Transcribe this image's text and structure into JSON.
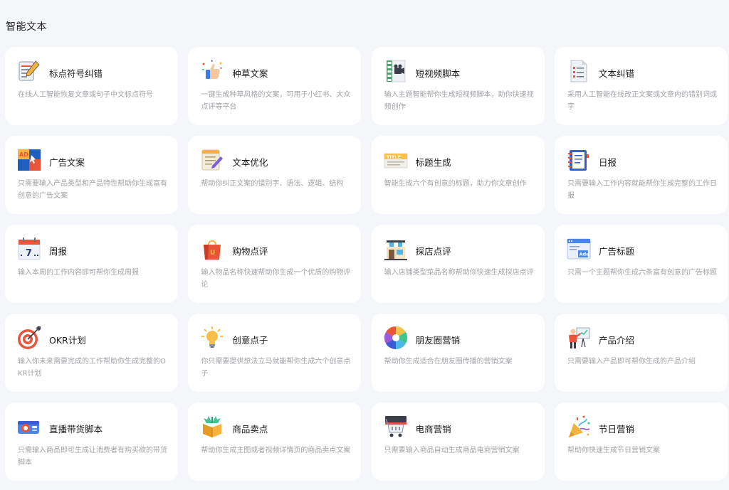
{
  "section": {
    "title": "智能文本"
  },
  "cards": [
    {
      "title": "标点符号纠错",
      "desc": "在线人工智能恢复文章或句子中文标点符号",
      "icon": "notepad-pencil-icon"
    },
    {
      "title": "种草文案",
      "desc": "一键生成种草风格的文案，可用于小红书、大众点评等平台",
      "icon": "thumbs-up-icon"
    },
    {
      "title": "短视频脚本",
      "desc": "输入主题智能帮你生成短视频脚本，助你快速视频创作",
      "icon": "film-camera-icon"
    },
    {
      "title": "文本纠错",
      "desc": "采用人工智能在线改正文案或文章内的错别词或字",
      "icon": "document-list-icon"
    },
    {
      "title": "广告文案",
      "desc": "只需要输入产品类型和产品特性帮助你生成富有创意的广告文案",
      "icon": "ad-board-icon"
    },
    {
      "title": "文本优化",
      "desc": "帮助你纠正文案的错别字、语法、逻辑、结构",
      "icon": "note-pen-icon"
    },
    {
      "title": "标题生成",
      "desc": "智能生成六个有创意的标题，助力你文章创作",
      "icon": "title-tag-icon"
    },
    {
      "title": "日报",
      "desc": "只需要输入工作内容就能帮你生成完整的工作日报",
      "icon": "notebook-icon"
    },
    {
      "title": "周报",
      "desc": "输入本周的工作内容即可帮你生成周报",
      "icon": "calendar-icon",
      "icon_text": "7"
    },
    {
      "title": "购物点评",
      "desc": "输入物品名称快速帮助你生成一个优质的购物评论",
      "icon": "shopping-bag-icon"
    },
    {
      "title": "探店点评",
      "desc": "输入店铺类型菜品名称帮助你快速生成探店点评",
      "icon": "storefront-icon"
    },
    {
      "title": "广告标题",
      "desc": "只需一个主题帮你生成六条富有创意的广告标题",
      "icon": "ads-window-icon",
      "icon_text": "Ads"
    },
    {
      "title": "OKR计划",
      "desc": "输入你未来需要完成的工作帮助你生成完整的OKR计划",
      "icon": "target-icon"
    },
    {
      "title": "创意点子",
      "desc": "你只需要提供想法立马就能帮你生成六个创意点子",
      "icon": "lightbulb-icon"
    },
    {
      "title": "朋友圈营销",
      "desc": "帮助你生成适合在朋友圈传播的营销文案",
      "icon": "aperture-icon"
    },
    {
      "title": "产品介绍",
      "desc": "只需要输入产品即可帮你生成的产品介绍",
      "icon": "presenter-icon"
    },
    {
      "title": "直播带货脚本",
      "desc": "只需输入商品即可生成让消费者有购买欲的带货脚本",
      "icon": "livestream-camera-icon"
    },
    {
      "title": "商品卖点",
      "desc": "帮助你生成主图或者视频详情页的商品卖点文案",
      "icon": "gift-box-icon"
    },
    {
      "title": "电商营销",
      "desc": "只需要输入商品自动生成商品电商营销文案",
      "icon": "shopping-cart-icon"
    },
    {
      "title": "节日营销",
      "desc": "帮助你快速生成节日营销文案",
      "icon": "party-popper-icon"
    }
  ]
}
